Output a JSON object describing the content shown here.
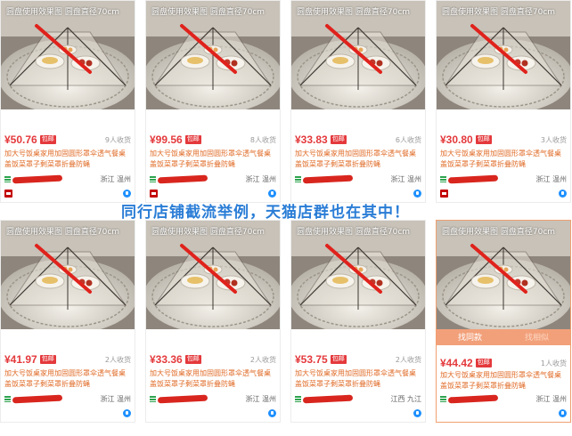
{
  "banner_text": "同行店铺截流举例，天猫店群也在其中！",
  "image_caption": "圆盘使用效果图  圆盘直径70cm",
  "free_shipping_badge": "包邮",
  "hover_actions": {
    "left": "找同款",
    "right": "找相似"
  },
  "product_title": "加大号饭桌家用加固圆形罩伞透气餐桌盖饭菜罩子剩菜罩折叠防蝇",
  "products": [
    {
      "price": "¥50.76",
      "sales": "9人收货",
      "location": "浙江 温州",
      "tmall": true
    },
    {
      "price": "¥99.56",
      "sales": "8人收货",
      "location": "浙江 温州",
      "tmall": true
    },
    {
      "price": "¥33.83",
      "sales": "6人收货",
      "location": "浙江 温州",
      "tmall": false
    },
    {
      "price": "¥30.80",
      "sales": "3人收货",
      "location": "浙江 温州",
      "tmall": true
    },
    {
      "price": "¥41.97",
      "sales": "2人收货",
      "location": "浙江 温州",
      "tmall": false
    },
    {
      "price": "¥33.36",
      "sales": "2人收货",
      "location": "浙江 温州",
      "tmall": false
    },
    {
      "price": "¥53.75",
      "sales": "2人收货",
      "location": "江西 九江",
      "tmall": false
    },
    {
      "price": "¥44.42",
      "sales": "1人收货",
      "location": "浙江 温州",
      "tmall": false,
      "hover": true
    }
  ],
  "colors": {
    "price": "#e4393c",
    "title": "#e06b27",
    "banner": "#2a7dd6",
    "hover_bar": "#f2a07a"
  }
}
